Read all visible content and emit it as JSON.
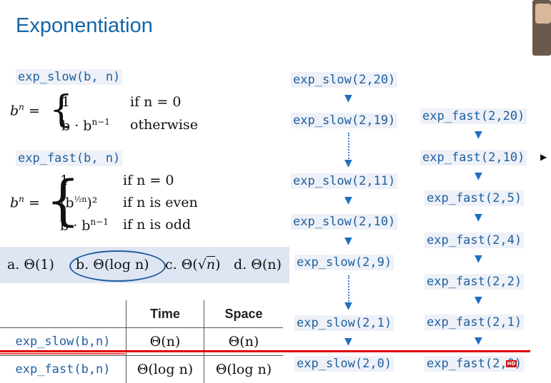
{
  "slide": {
    "title": "Exponentiation"
  },
  "defs": {
    "slow_sig": "exp_slow(b, n)",
    "fast_sig": "exp_fast(b, n)",
    "bn": "b",
    "bn_exp": "n",
    "eq": "=",
    "slow_case1_expr": "1",
    "slow_case1_cond": "if n = 0",
    "slow_case2_expr": "b · b",
    "slow_case2_exp": "n−1",
    "slow_case2_cond": "otherwise",
    "fast_case1_expr": "1",
    "fast_case1_cond": "if n = 0",
    "fast_case2_expr": "(b",
    "fast_case2_exp": "½n",
    "fast_case2_tail": ")²",
    "fast_case2_cond": "if n is even",
    "fast_case3_expr": "b · b",
    "fast_case3_exp": "n−1",
    "fast_case3_cond": "if n is odd"
  },
  "choices": {
    "a": "a. Θ(1)",
    "b": "b. Θ(log n)",
    "c_prefix": "c. Θ(",
    "c_radical": "√",
    "c_n": "n",
    "c_suffix": ")",
    "d": "d. Θ(n)",
    "selected": "b"
  },
  "table": {
    "headers": [
      "",
      "Time",
      "Space"
    ],
    "rows": [
      {
        "name": "exp_slow(b,n)",
        "time": "Θ(n)",
        "space": "Θ(n)"
      },
      {
        "name": "exp_fast(b,n)",
        "time": "Θ(log n)",
        "space": "Θ(log n)"
      }
    ]
  },
  "slow_calls": [
    "exp_slow(2,20)",
    "exp_slow(2,19)",
    "exp_slow(2,11)",
    "exp_slow(2,10)",
    "exp_slow(2,9)",
    "exp_slow(2,1)",
    "exp_slow(2,0)"
  ],
  "fast_calls": [
    "exp_fast(2,20)",
    "exp_fast(2,10)",
    "exp_fast(2,5)",
    "exp_fast(2,4)",
    "exp_fast(2,2)",
    "exp_fast(2,1)",
    "exp_fast(2,0)"
  ],
  "badge": "HD",
  "colors": {
    "title": "#1565a8",
    "code": "#1f5fa0",
    "arrow": "#1f6fc1",
    "highlight_bg": "#dfe6f3",
    "annotation_red": "#e00000"
  },
  "icons": [
    "down-arrow-icon",
    "mouse-cursor-icon",
    "hd-badge-icon"
  ]
}
